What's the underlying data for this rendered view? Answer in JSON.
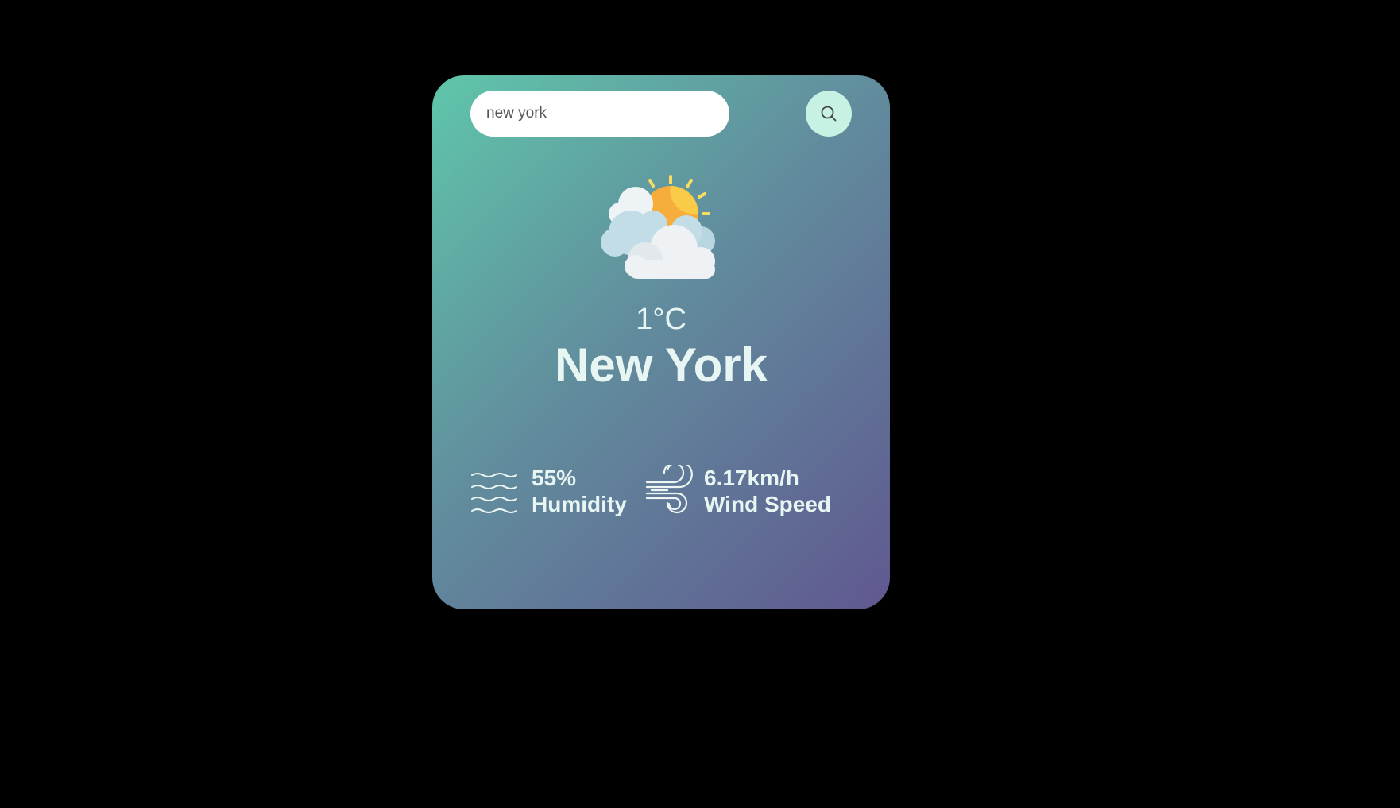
{
  "search": {
    "value": "new york",
    "placeholder": ""
  },
  "weather": {
    "icon": "partly-cloudy-icon",
    "temperature": "1°C",
    "city": "New York"
  },
  "details": {
    "humidity_value": "55%",
    "humidity_label": "Humidity",
    "humidity_icon": "humidity-waves-icon",
    "wind_value": "6.17km/h",
    "wind_label": "Wind Speed",
    "wind_icon": "wind-icon"
  },
  "colors": {
    "page_background": "#000000",
    "card_gradient_start": "#5fc6aa",
    "card_gradient_end": "#605890",
    "search_button_bg": "#c6f1e3",
    "text": "#e8f6f3"
  }
}
